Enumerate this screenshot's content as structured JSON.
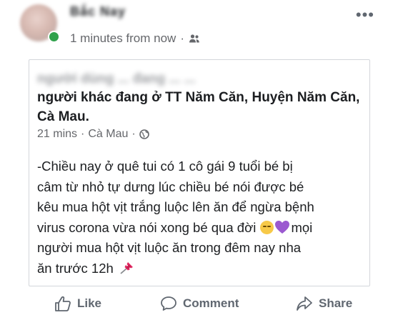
{
  "post": {
    "author_name": "Bắc Nay",
    "timestamp": "1 minutes from now",
    "separator": "·",
    "audience_icon": "friends-icon",
    "more_icon": "more-options-icon",
    "more_label": "•••"
  },
  "shared_post": {
    "blurred_line": "người dùng ... đang ... ...",
    "location_text": "người khác đang ở TT Năm Căn, Huyện Năm Căn, Cà Mau.",
    "time": "21 mins",
    "separator1": "·",
    "place": "Cà Mau",
    "separator2": "·",
    "privacy_icon": "globe-icon",
    "body": {
      "line1": "-Chiều nay ở quê tui có 1 cô gái 9 tuổi bé bị",
      "line2": "câm từ nhỏ tự dưng lúc chiều bé nói được bé",
      "line3": "kêu mua hột vịt trắng luộc lên ăn để ngừa bệnh",
      "line4a": "virus corona vừa nói xong bé qua đời",
      "line4b": "mọi",
      "line5": "người mua hột vịt luộc ăn trong đêm nay nha",
      "line6": "ăn trước 12h"
    }
  },
  "actions": {
    "like_label": "Like",
    "comment_label": "Comment",
    "share_label": "Share"
  },
  "colors": {
    "text": "#1c1e21",
    "meta": "#65676b",
    "online": "#31a24c",
    "heart": "#9b59d0",
    "pin": "#e0245e"
  }
}
